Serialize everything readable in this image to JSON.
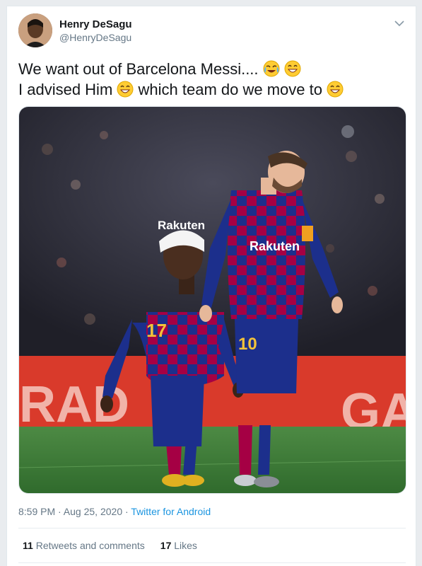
{
  "tweet": {
    "author_name": "Henry DeSagu",
    "author_handle": "@HenryDeSagu",
    "text_line1": "We want out of Barcelona Messi....",
    "text_line2_a": "I advised Him",
    "text_line2_b": " which team do we move to",
    "emoji_icons": [
      "tears-of-joy-emoji",
      "grinning-emoji",
      "grinning-emoji",
      "grinning-emoji"
    ],
    "timestamp": "8:59 PM · Aug 25, 2020 · ",
    "source": "Twitter for Android",
    "retweets_count": "11",
    "retweets_label": "Retweets and comments",
    "likes_count": "17",
    "likes_label": "Likes"
  },
  "media": {
    "sponsor_left": "Rakuten",
    "sponsor_right": "Rakuten",
    "number_left": "17",
    "number_right": "10",
    "board_left": "RAD",
    "board_right": "GA"
  },
  "colors": {
    "link": "#1b95e0",
    "secondary_text": "#657786",
    "barca_red": "#a50044",
    "barca_blue": "#1c2f8c",
    "pitch": "#3f7d3a",
    "board_red": "#d93a2b"
  }
}
